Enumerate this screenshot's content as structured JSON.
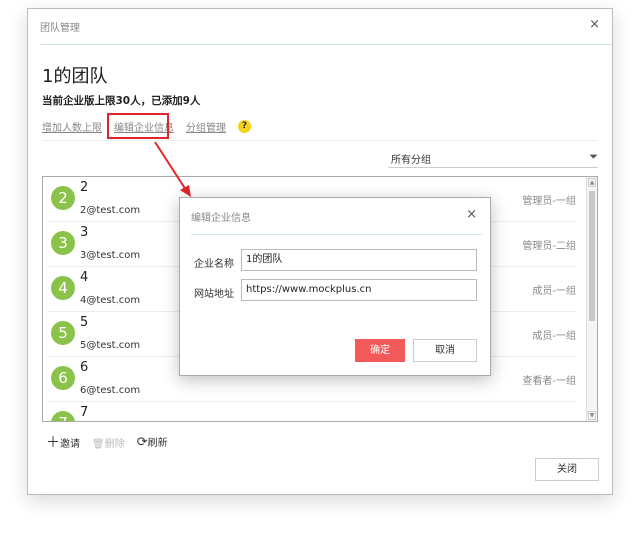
{
  "dialog": {
    "title": "团队管理",
    "close": "×",
    "team_name": "1的团队",
    "quota": "当前企业版上限30人，已添加9人",
    "links": [
      "增加人数上限",
      "编辑企业信息",
      "分组管理"
    ],
    "help": "?",
    "filter": "所有分组",
    "members": [
      {
        "avatar": "2",
        "name": "2",
        "email": "2@test.com",
        "role": "管理员-一组"
      },
      {
        "avatar": "3",
        "name": "3",
        "email": "3@test.com",
        "role": "管理员-二组"
      },
      {
        "avatar": "4",
        "name": "4",
        "email": "4@test.com",
        "role": "成员-一组"
      },
      {
        "avatar": "5",
        "name": "5",
        "email": "5@test.com",
        "role": "成员-一组"
      },
      {
        "avatar": "6",
        "name": "6",
        "email": "6@test.com",
        "role": "查看者-一组"
      },
      {
        "avatar": "7",
        "name": "7",
        "email": "",
        "role": ""
      }
    ],
    "tools": {
      "invite": "邀请",
      "delete": "删除",
      "refresh": "刷新"
    },
    "close_button": "关闭"
  },
  "modal": {
    "title": "编辑企业信息",
    "close": "×",
    "name_label": "企业名称",
    "name_value": "1的团队",
    "site_label": "网站地址",
    "site_value": "https://www.mockplus.cn",
    "ok": "确定",
    "cancel": "取消"
  },
  "colors": {
    "accent": "#f25a5a",
    "avatar": "#8bc34a",
    "annotation": "#e0262b"
  }
}
